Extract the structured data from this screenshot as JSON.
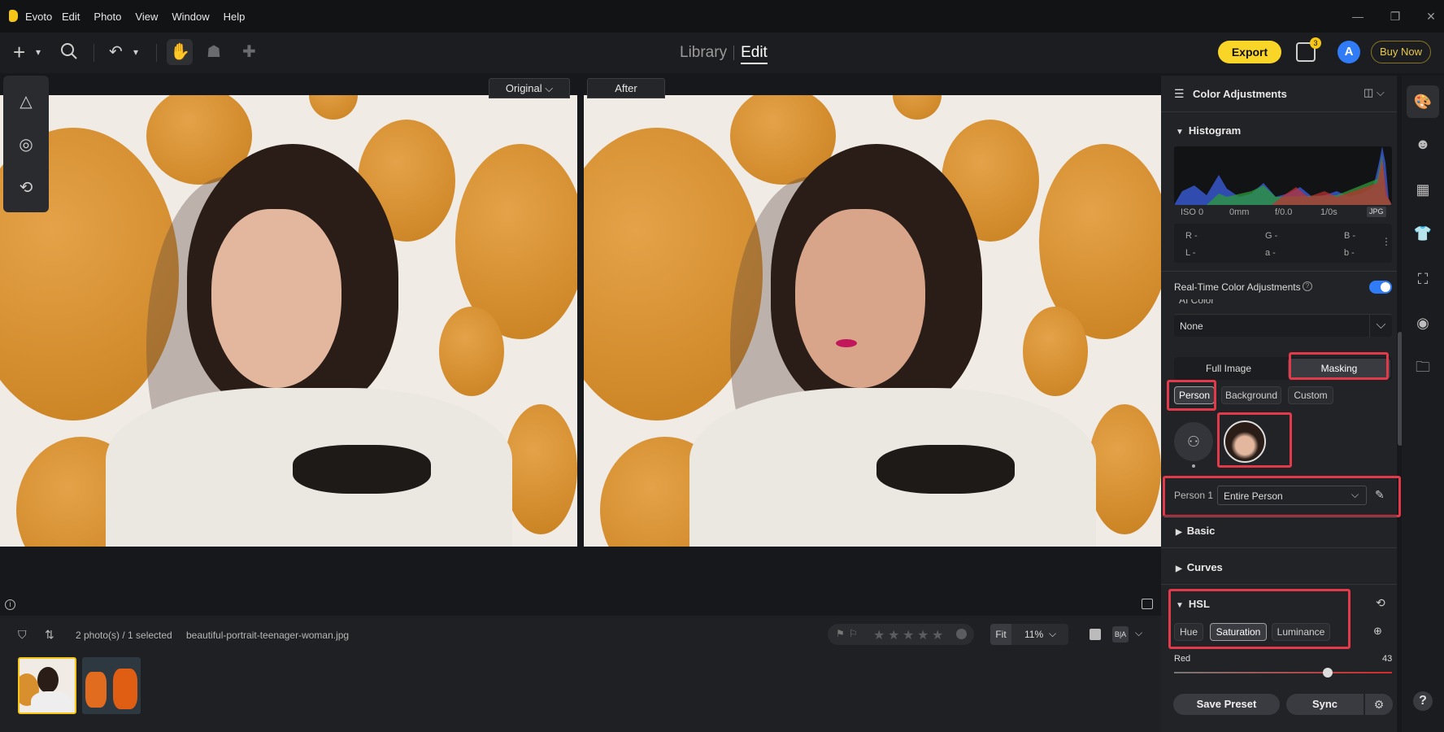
{
  "app": {
    "name": "Evoto",
    "menus": [
      "Edit",
      "Photo",
      "View",
      "Window",
      "Help"
    ]
  },
  "toolbar": {
    "view_library": "Library",
    "view_edit": "Edit",
    "export": "Export",
    "queue_count": "3",
    "avatar_letter": "A",
    "buy_now": "Buy Now"
  },
  "compare": {
    "original": "Original",
    "after": "After"
  },
  "filmstrip": {
    "count_text": "2 photo(s) / 1 selected",
    "filename": "beautiful-portrait-teenager-woman.jpg",
    "fit": "Fit",
    "zoom": "11%",
    "rating": 0
  },
  "panel": {
    "title": "Color Adjustments",
    "histogram": {
      "title": "Histogram",
      "iso": "ISO 0",
      "focal": "0mm",
      "aperture": "f/0.0",
      "shutter": "1/0s",
      "format": "JPG",
      "r": "R -",
      "g": "G -",
      "b": "B -",
      "l": "L -",
      "a": "a -",
      "b2": "b -"
    },
    "realtime_label": "Real-Time Color Adjustments",
    "ai_color_label": "AI Color",
    "ai_color_value": "None",
    "mode_tabs": [
      "Full Image",
      "Masking"
    ],
    "mask_tabs": [
      "Person",
      "Background",
      "Custom"
    ],
    "person_label": "Person 1",
    "person_select": "Entire Person",
    "sections": {
      "basic": "Basic",
      "curves": "Curves",
      "hsl": "HSL"
    },
    "hsl_tabs": [
      "Hue",
      "Saturation",
      "Luminance"
    ],
    "slider": {
      "label": "Red",
      "value": "43"
    },
    "save_preset": "Save Preset",
    "sync": "Sync"
  },
  "colors": {
    "accent_yellow": "#f9d527",
    "highlight_red": "#e23a4a",
    "toggle_blue": "#2f7cf6"
  }
}
